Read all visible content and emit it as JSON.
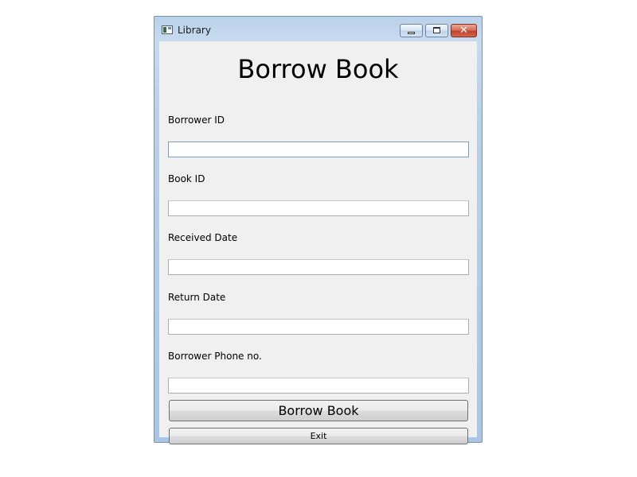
{
  "window": {
    "title": "Library",
    "icon": "app-window-icon",
    "controls": {
      "minimize": "minimize-icon",
      "maximize": "maximize-icon",
      "close_glyph": "✕"
    }
  },
  "form": {
    "heading": "Borrow Book",
    "fields": [
      {
        "label": "Borrower ID",
        "value": "",
        "placeholder": ""
      },
      {
        "label": "Book ID",
        "value": "",
        "placeholder": ""
      },
      {
        "label": "Received Date",
        "value": "",
        "placeholder": ""
      },
      {
        "label": "Return Date",
        "value": "",
        "placeholder": ""
      },
      {
        "label": "Borrower Phone no.",
        "value": "",
        "placeholder": ""
      }
    ],
    "focused_field": "Borrower ID"
  },
  "buttons": {
    "borrow_label": "Borrow Book",
    "exit_label": "Exit"
  },
  "colors": {
    "frame": "#b9d1ea",
    "client_bg": "#f0f0f0",
    "close_button": "#c0442c",
    "focus_border": "#7a9cc6"
  }
}
